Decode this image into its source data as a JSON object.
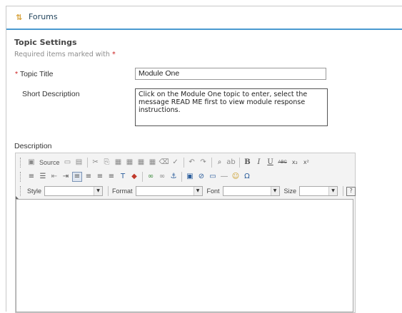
{
  "header": {
    "title": "Forums",
    "icon": "forums-arrows-icon"
  },
  "topic_settings": {
    "title": "Topic Settings",
    "required_note": "Required items marked with",
    "required_star": "*"
  },
  "fields": {
    "topic_title": {
      "star": "*",
      "label": "Topic Title",
      "value": "Module One"
    },
    "short_description": {
      "label": "Short Description",
      "value": "Click on the Module One topic to enter, select the message READ ME first to view module response instructions."
    },
    "description": {
      "label": "Description"
    }
  },
  "editor": {
    "source_label": "Source",
    "style_label": "Style",
    "format_label": "Format",
    "font_label": "Font",
    "size_label": "Size",
    "bold_glyph": "B",
    "italic_glyph": "I",
    "underline_glyph": "U",
    "strike_glyph": "ABC",
    "subscript_glyph": "x₂",
    "superscript_glyph": "x²",
    "help_glyph": "?"
  }
}
